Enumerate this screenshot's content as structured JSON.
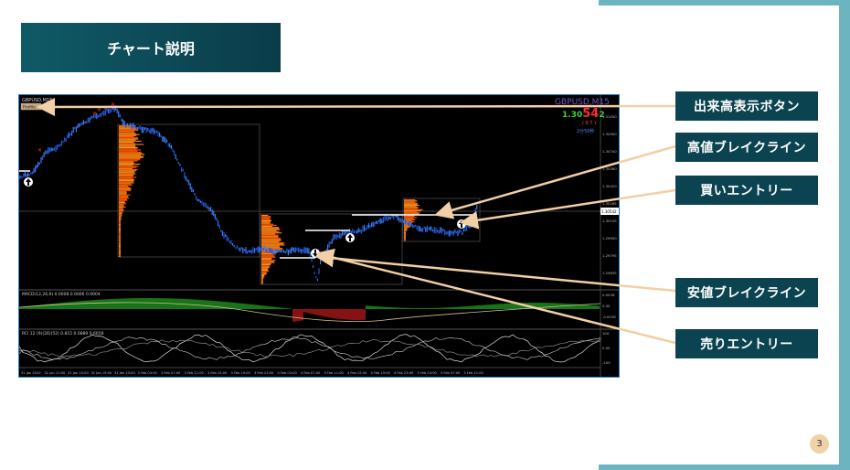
{
  "slide": {
    "title": "チャート説明",
    "page_number": "3"
  },
  "chart": {
    "symbol_window": "GBPUSD,M15",
    "button_label": "Profile",
    "watermark": "GBPUSD,M15",
    "price": {
      "prefix": "1.30",
      "big": "54",
      "suffix": "2"
    },
    "spread": "( 0.7 )",
    "timer": "2分50秒",
    "price_axis": [
      "1.31050",
      "1.30900",
      "1.30740",
      "1.30580",
      "1.30420",
      "1.30265",
      "1.30105",
      "1.29950",
      "1.29795",
      "1.29635"
    ],
    "current_price_tag": "1.30542",
    "macd_label": "MACD(12,26,9) 0.0008 0.0006 0.0004",
    "macd_axis": [
      "0.0036",
      "0.00",
      "-0.0036"
    ],
    "rci_label": "RCI 12 (9)(26)(52) 0.815 0.0889 0.6658",
    "rci_axis": [
      "100",
      "0.00",
      "-100"
    ],
    "time_axis": [
      "31 Jan 2020",
      "31 Jan 11:00",
      "31 Jan 15:00",
      "31 Jan 19:00",
      "31 Jan 23:00",
      "3 Feb 03:00",
      "3 Feb 07:00",
      "3 Feb 11:00",
      "3 Feb 15:00",
      "3 Feb 19:00",
      "3 Feb 23:00",
      "4 Feb 03:00",
      "4 Feb 07:00",
      "4 Feb 11:00",
      "4 Feb 15:00",
      "4 Feb 19:00",
      "4 Feb 23:00",
      "5 Feb 03:00",
      "5 Feb 07:00",
      "5 Feb 11:00"
    ]
  },
  "callouts": {
    "volume_button": "出来高表示ボタン",
    "high_break": "高値ブレイクライン",
    "buy_entry": "買いエントリー",
    "low_break": "安値ブレイクライン",
    "sell_entry": "売りエントリー"
  },
  "colors": {
    "frame": "#6cb4c0",
    "title_bg": "#0f5a66",
    "callout_bg": "#0b4350",
    "arrow": "#f2cfa5",
    "candle": "#1e5ad8",
    "profile": "#ff5a00"
  }
}
